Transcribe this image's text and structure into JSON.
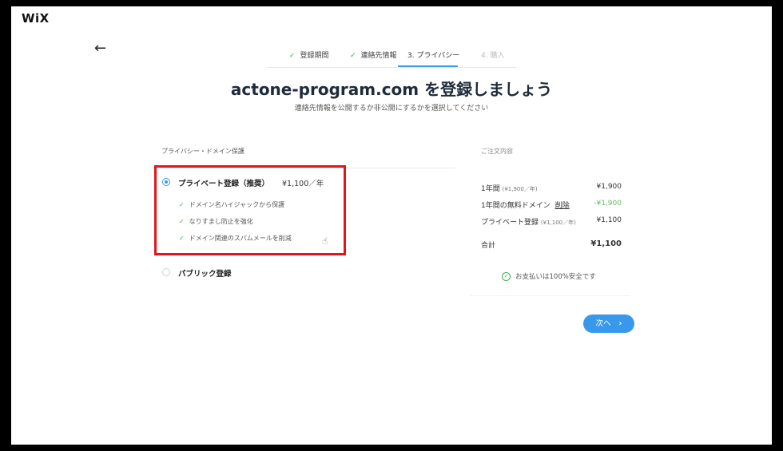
{
  "logo": "WiX",
  "back_icon": "←",
  "steps": [
    {
      "label": "登録期間",
      "state": "done"
    },
    {
      "label": "連絡先情報",
      "state": "done"
    },
    {
      "label": "3. プライバシー",
      "state": "current"
    },
    {
      "label": "4. 購入",
      "state": "future"
    }
  ],
  "title": "actone-program.com を登録しましょう",
  "subtitle": "連絡先情報を公開するか非公開にするかを選択してください",
  "privacy": {
    "section_label": "プライバシー・ドメイン保護",
    "private": {
      "label": "プライベート登録（推奨）",
      "price": "¥1,100／年",
      "selected": true,
      "benefits": [
        "ドメイン名ハイジャックから保護",
        "なりすまし防止を強化",
        "ドメイン関連のスパムメールを削減"
      ]
    },
    "public": {
      "label": "パブリック登録",
      "selected": false
    }
  },
  "summary": {
    "title": "ご注文内容",
    "rows": [
      {
        "label": "1年間",
        "note": "(¥1,900／年)",
        "value": "¥1,900"
      },
      {
        "label": "1年間の無料ドメイン",
        "link": "削除",
        "value": "-¥1,900",
        "value_color": "#5fbf5f"
      },
      {
        "label": "プライベート登録",
        "note": "(¥1,100／年)",
        "value": "¥1,100"
      }
    ],
    "total_label": "合計",
    "total_value": "¥1,100",
    "secure_text": "お支払いは100%安全です"
  },
  "next_button": "次へ",
  "colors": {
    "accent": "#3899ec",
    "check": "#3fae4a",
    "highlight": "#e0161b"
  }
}
